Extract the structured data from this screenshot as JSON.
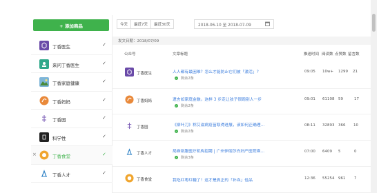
{
  "sidebar": {
    "add_button": "+ 添加商品",
    "items": [
      {
        "name": "丁香医生",
        "check": "✓",
        "active": false
      },
      {
        "name": "来问丁香医生",
        "check": "✓",
        "active": false
      },
      {
        "name": "丁香家庭健康",
        "check": "✓",
        "active": false
      },
      {
        "name": "丁香妈妈",
        "check": "✓",
        "active": false
      },
      {
        "name": "丁香园",
        "check": "✓",
        "active": false
      },
      {
        "name": "科学性",
        "check": "✓",
        "active": false
      },
      {
        "name": "丁香食堂",
        "check": "✓",
        "active": true,
        "close": "×"
      },
      {
        "name": "丁香人才",
        "check": "✓",
        "active": false
      }
    ]
  },
  "filters": {
    "today": "今天",
    "last7": "最近7天",
    "last30": "最近30天",
    "date_range": "2018-06-10 至 2018-07-09"
  },
  "section": {
    "label": "发文日期：2018/07/09"
  },
  "columns": {
    "account": "公众号",
    "title": "文章标题",
    "push_time": "推送时间",
    "reads": "阅读数",
    "likes": "点赞数",
    "comments": "留言数"
  },
  "rows": [
    {
      "account": "丁香医生",
      "title": "人人都有最困难？怎么才能防止它们被「激活」？",
      "status": "剩余2条",
      "time": "09:05",
      "reads": "10w+",
      "likes": "1299",
      "comments": "21"
    },
    {
      "account": "丁香妈妈",
      "title": "遗言如家庭金融，这样 3 步走让孩子很跑别人一步",
      "status": "剩余2条",
      "time": "09:01",
      "reads": "61108",
      "likes": "59",
      "comments": "17"
    },
    {
      "account": "丁香园",
      "title": "《柳叶刀》称艾滋病疫苗取得进展，该如何正确理…",
      "status": "剩余2条",
      "time": "08:11",
      "reads": "32893",
      "likes": "366",
      "comments": "10"
    },
    {
      "account": "丁香人才",
      "title": "局麻剖腹医疗机构招聘 | 广州伊丽莎白妇产医院唤…",
      "status": "剩余3条",
      "time": "07:00",
      "reads": "6409",
      "likes": "5",
      "comments": "0"
    },
    {
      "account": "丁香食堂",
      "title": "我吃红枣红糖了！这才是真正的「补血」佳品",
      "status": "",
      "time": "12:36",
      "reads": "55254",
      "likes": "961",
      "comments": "7"
    }
  ],
  "colors": {
    "accent": "#3fb24c",
    "link": "#3b7ddd"
  }
}
